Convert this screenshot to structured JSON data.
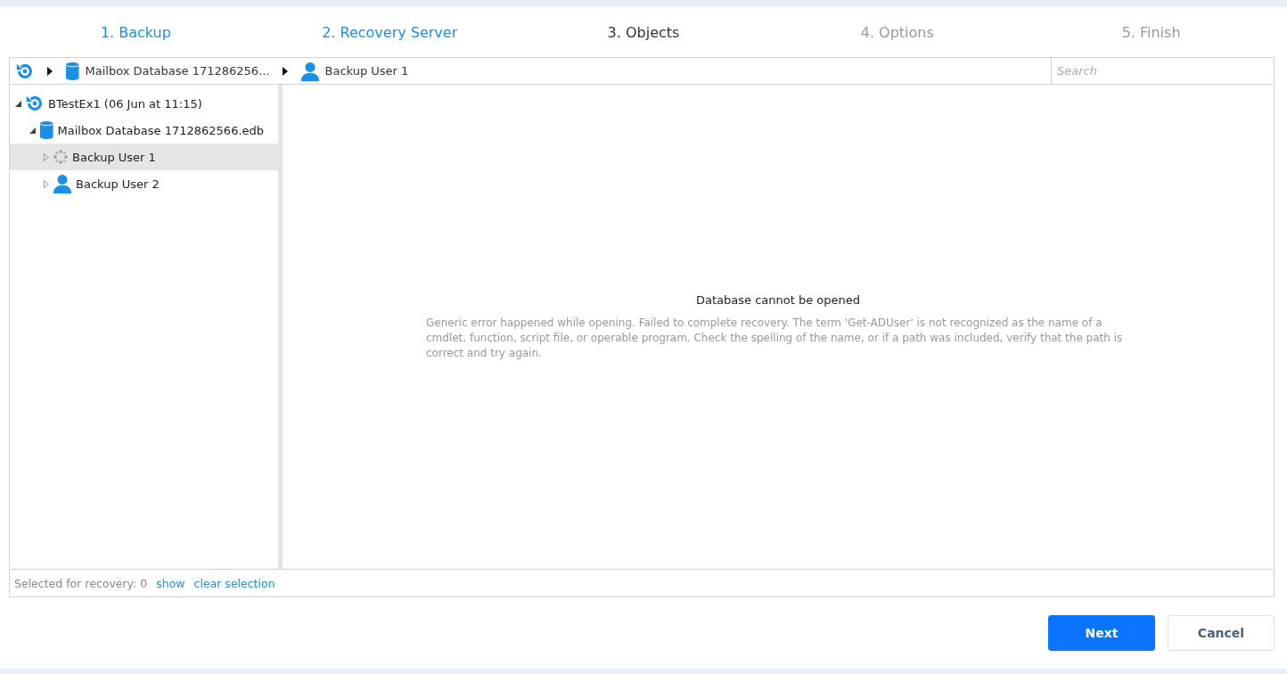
{
  "steps": [
    {
      "label": "1. Backup",
      "kind": "done"
    },
    {
      "label": "2. Recovery Server",
      "kind": "done"
    },
    {
      "label": "3. Objects",
      "kind": "current"
    },
    {
      "label": "4. Options",
      "kind": "pending"
    },
    {
      "label": "5. Finish",
      "kind": "pending"
    }
  ],
  "breadcrumb": [
    {
      "kind": "backup"
    },
    {
      "kind": "database",
      "label": "Mailbox Database 171286256..."
    },
    {
      "kind": "user",
      "label": "Backup User 1"
    }
  ],
  "search": {
    "placeholder": "Search"
  },
  "tree": [
    {
      "kind": "backup",
      "label": "BTestEx1 (06 Jun at 11:15)",
      "expanded": true,
      "selected": false,
      "children": [
        {
          "kind": "database",
          "label": "Mailbox Database 1712862566.edb",
          "expanded": true,
          "selected": false,
          "children": [
            {
              "kind": "loading",
              "label": "Backup User 1",
              "expanded": false,
              "selected": true
            },
            {
              "kind": "user",
              "label": "Backup User 2",
              "expanded": false,
              "selected": false
            }
          ]
        }
      ]
    }
  ],
  "message": {
    "title": "Database cannot be opened",
    "detail": "Generic error happened while opening. Failed to complete recovery. The term 'Get-ADUser' is not recognized as the name of a cmdlet, function, script file, or operable program. Check the spelling of the name, or if a path was included, verify that the path is correct and try again."
  },
  "footer": {
    "selected_text": "Selected for recovery: 0",
    "links": [
      "show",
      "clear selection"
    ]
  },
  "buttons": [
    {
      "label": "Next",
      "kind": "primary"
    },
    {
      "label": "Cancel",
      "kind": "secondary"
    }
  ]
}
